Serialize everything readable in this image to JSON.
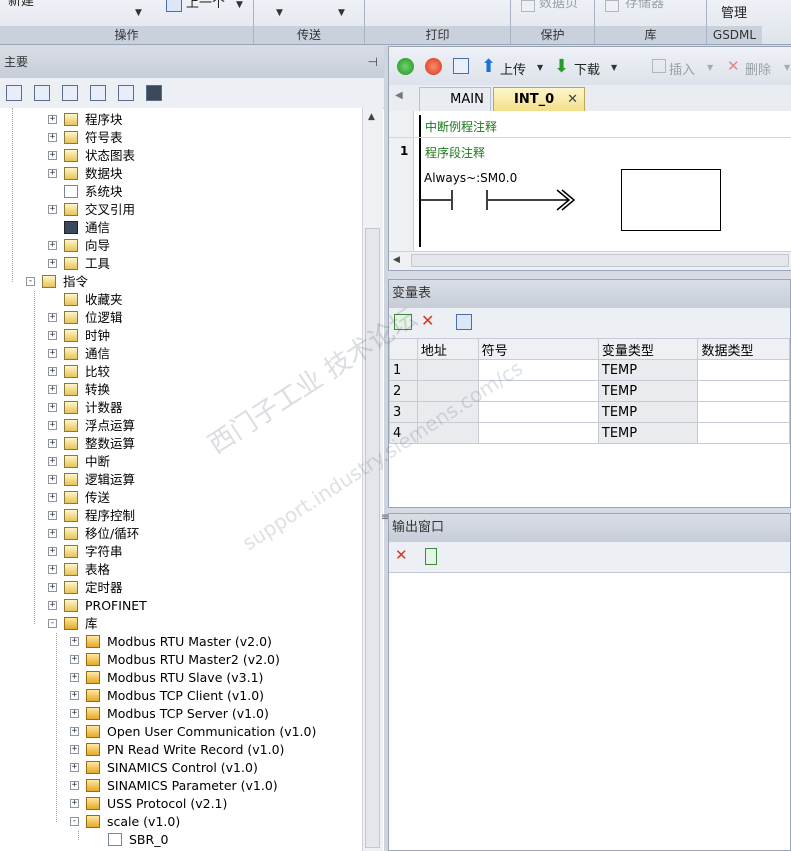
{
  "ribbon": {
    "groups": [
      {
        "label": "操作"
      },
      {
        "label": "传送"
      },
      {
        "label": "打印"
      },
      {
        "label": "保护"
      },
      {
        "label": "库"
      },
      {
        "label": "GSDML"
      }
    ],
    "buttons": {
      "new": "新建",
      "prev": "上一个",
      "data_page": "数据页",
      "memory": "存储器",
      "manage": "管理"
    }
  },
  "left_panel": {
    "title": "主要",
    "tree": [
      {
        "label": "程序块"
      },
      {
        "label": "符号表"
      },
      {
        "label": "状态图表"
      },
      {
        "label": "数据块"
      },
      {
        "label": "系统块"
      },
      {
        "label": "交叉引用"
      },
      {
        "label": "通信"
      },
      {
        "label": "向导"
      },
      {
        "label": "工具"
      },
      {
        "label": "指令"
      },
      {
        "label": "收藏夹"
      },
      {
        "label": "位逻辑"
      },
      {
        "label": "时钟"
      },
      {
        "label": "通信"
      },
      {
        "label": "比较"
      },
      {
        "label": "转换"
      },
      {
        "label": "计数器"
      },
      {
        "label": "浮点运算"
      },
      {
        "label": "整数运算"
      },
      {
        "label": "中断"
      },
      {
        "label": "逻辑运算"
      },
      {
        "label": "传送"
      },
      {
        "label": "程序控制"
      },
      {
        "label": "移位/循环"
      },
      {
        "label": "字符串"
      },
      {
        "label": "表格"
      },
      {
        "label": "定时器"
      },
      {
        "label": "PROFINET"
      },
      {
        "label": "库"
      },
      {
        "label": "Modbus RTU Master (v2.0)"
      },
      {
        "label": "Modbus RTU Master2 (v2.0)"
      },
      {
        "label": "Modbus RTU Slave (v3.1)"
      },
      {
        "label": "Modbus TCP Client (v1.0)"
      },
      {
        "label": "Modbus TCP Server (v1.0)"
      },
      {
        "label": "Open User Communication (v1.0)"
      },
      {
        "label": "PN Read Write Record (v1.0)"
      },
      {
        "label": "SINAMICS Control (v1.0)"
      },
      {
        "label": "SINAMICS Parameter (v1.0)"
      },
      {
        "label": "USS Protocol (v2.1)"
      },
      {
        "label": "scale (v1.0)"
      },
      {
        "label": "SBR_0"
      }
    ]
  },
  "editor": {
    "toolbar": {
      "upload": "上传",
      "download": "下载",
      "insert": "插入",
      "delete": "删除"
    },
    "tabs": [
      {
        "label": "MAIN"
      },
      {
        "label": "INT_0"
      }
    ],
    "routine_comment": "中断例程注释",
    "network_number": "1",
    "network_comment": "程序段注释",
    "contact_label": "Always~:SM0.0"
  },
  "var_table": {
    "title": "变量表",
    "columns": [
      "地址",
      "符号",
      "变量类型",
      "数据类型"
    ],
    "rows": [
      {
        "num": "1",
        "address": "",
        "symbol": "",
        "var_type": "TEMP",
        "data_type": ""
      },
      {
        "num": "2",
        "address": "",
        "symbol": "",
        "var_type": "TEMP",
        "data_type": ""
      },
      {
        "num": "3",
        "address": "",
        "symbol": "",
        "var_type": "TEMP",
        "data_type": ""
      },
      {
        "num": "4",
        "address": "",
        "symbol": "",
        "var_type": "TEMP",
        "data_type": ""
      }
    ]
  },
  "output": {
    "title": "输出窗口"
  },
  "watermark": {
    "line1": "西门子工业 技术论坛",
    "line2": "support.industry.siemens.com/cs"
  },
  "colors": {
    "comment_green": "#1a7a1a",
    "accent_blue": "#1e6fd9",
    "panel_title": "#c7cdd7"
  }
}
